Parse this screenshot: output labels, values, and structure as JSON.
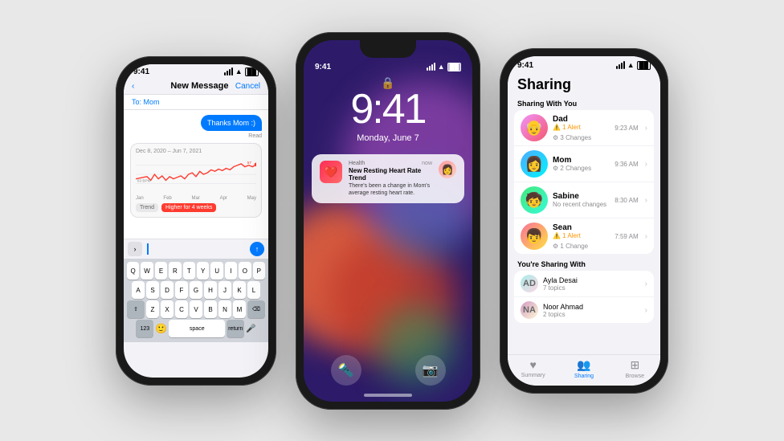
{
  "page": {
    "background": "#e8e8e8"
  },
  "phone1": {
    "status_time": "9:41",
    "header_title": "New Message",
    "header_cancel": "Cancel",
    "to_label": "To:",
    "to_contact": "Mom",
    "bubble_text": "Thanks Mom :)",
    "read_status": "Read",
    "health_card": {
      "date_range": "Dec 8, 2020 – Jun 7, 2021",
      "trend_label": "Trend",
      "trend_value": "Higher for 4 weeks",
      "bpm_label": "63 BPM"
    },
    "keyboard": {
      "rows": [
        [
          "Q",
          "W",
          "E",
          "R",
          "T",
          "Y",
          "U",
          "I",
          "O",
          "P"
        ],
        [
          "A",
          "S",
          "D",
          "F",
          "G",
          "H",
          "J",
          "K",
          "L"
        ],
        [
          "Z",
          "X",
          "C",
          "V",
          "B",
          "N",
          "M"
        ]
      ],
      "num_key": "123",
      "space_key": "space",
      "return_key": "return"
    }
  },
  "phone2": {
    "time": "9:41",
    "date": "Monday, June 7",
    "notification": {
      "app": "Health",
      "title": "New Resting Heart Rate Trend",
      "time": "now",
      "body": "There's been a change in Mom's average resting heart rate.",
      "icon": "❤️"
    }
  },
  "phone3": {
    "status_time": "9:41",
    "title": "Sharing",
    "section1": "Sharing With You",
    "people": [
      {
        "name": "Dad",
        "time": "9:23 AM",
        "alert": "1 Alert",
        "change": "3 Changes",
        "emoji": "👴"
      },
      {
        "name": "Mom",
        "time": "9:36 AM",
        "alert": "",
        "change": "2 Changes",
        "emoji": "👩"
      },
      {
        "name": "Sabine",
        "time": "8:30 AM",
        "alert": "",
        "change": "No recent changes",
        "emoji": "🧒"
      },
      {
        "name": "Sean",
        "time": "7:59 AM",
        "alert": "1 Alert",
        "change": "1 Change",
        "emoji": "👦"
      }
    ],
    "section2": "You're Sharing With",
    "sharing_with": [
      {
        "name": "Ayla Desai",
        "sub": "7 topics",
        "initials": "AD"
      },
      {
        "name": "Noor Ahmad",
        "sub": "2 topics",
        "initials": "NA"
      }
    ],
    "tabs": [
      {
        "label": "Summary",
        "icon": "♥",
        "active": false
      },
      {
        "label": "Sharing",
        "icon": "👥",
        "active": true
      },
      {
        "label": "Browse",
        "icon": "⊞",
        "active": false
      }
    ]
  }
}
